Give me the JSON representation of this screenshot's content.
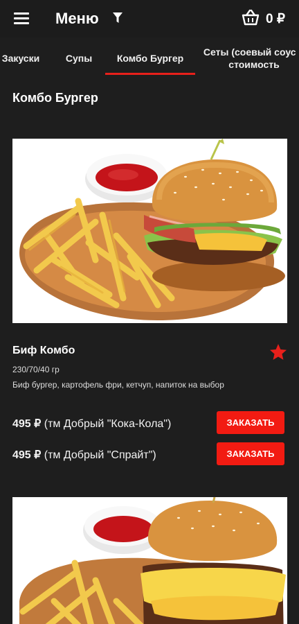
{
  "header": {
    "title": "Меню",
    "cart_amount": "0 ₽"
  },
  "tabs": [
    {
      "label": "Закуски",
      "active": false
    },
    {
      "label": "Супы",
      "active": false
    },
    {
      "label": "Комбо Бургер",
      "active": true
    },
    {
      "label": "Сеты (соевый соус в стоимость",
      "active": false
    }
  ],
  "section": {
    "title": "Комбо Бургер"
  },
  "products": [
    {
      "name": "Биф Комбо",
      "weight": "230/70/40 гр",
      "description": "Биф бургер, картофель фри, кетчуп, напиток на выбор",
      "favorite": true,
      "options": [
        {
          "price": "495 ₽",
          "drink": " (тм Добрый \"Кока-Кола\")",
          "button": "ЗАКАЗАТЬ"
        },
        {
          "price": "495 ₽",
          "drink": " (тм Добрый \"Спрайт\")",
          "button": "ЗАКАЗАТЬ"
        }
      ]
    }
  ],
  "colors": {
    "background": "#1e1e1e",
    "accent": "#f21b12",
    "tab_indicator": "#e8201b",
    "favorite_star": "#e8201b"
  }
}
